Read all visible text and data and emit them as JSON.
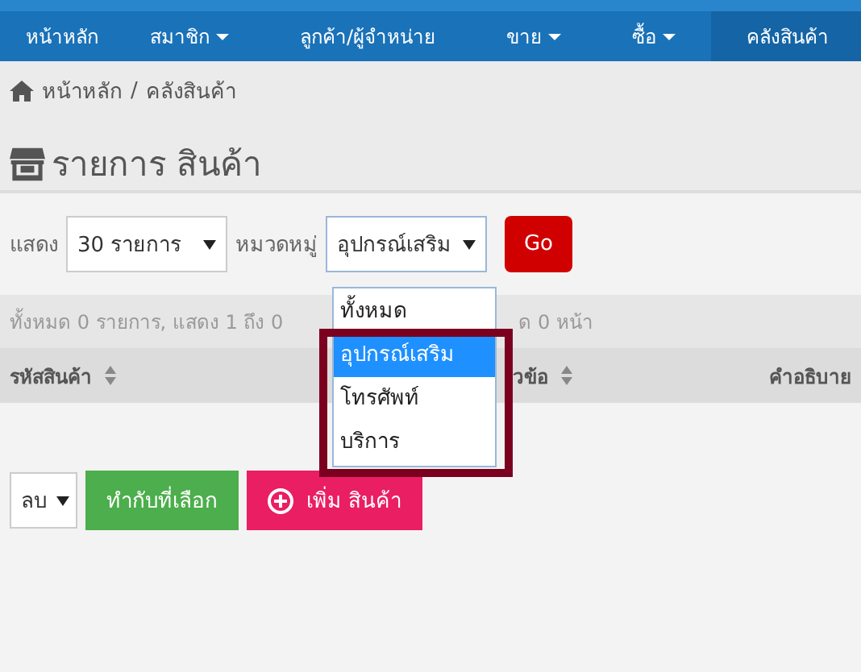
{
  "navbar": {
    "items": [
      {
        "label": "หน้าหลัก",
        "dropdown": false,
        "selected": false
      },
      {
        "label": "สมาชิก",
        "dropdown": true,
        "selected": false
      },
      {
        "label": "ลูกค้า/ผู้จำหน่าย",
        "dropdown": false,
        "selected": false
      },
      {
        "label": "ขาย",
        "dropdown": true,
        "selected": false
      },
      {
        "label": "ซื้อ",
        "dropdown": true,
        "selected": false
      },
      {
        "label": "คลังสินค้า",
        "dropdown": false,
        "selected": true
      }
    ]
  },
  "breadcrumb": [
    "หน้าหลัก",
    "/",
    "คลังสินค้า"
  ],
  "page_title": "รายการ สินค้า",
  "filters": {
    "show_label": "แสดง",
    "show_value": "30 รายการ",
    "category_label": "หมวดหมู่",
    "category_value": "อุปกรณ์เสริม",
    "go_button": "Go"
  },
  "category_options": [
    {
      "label": "ทั้งหมด",
      "selected": false
    },
    {
      "label": "อุปกรณ์เสริม",
      "selected": true
    },
    {
      "label": "โทรศัพท์",
      "selected": false
    },
    {
      "label": "บริการ",
      "selected": false
    }
  ],
  "info_text": [
    "ทั้งหมด 0 รายการ, แสดง 1 ถึง 0",
    "ด 0 หน้า"
  ],
  "table": {
    "columns": [
      {
        "label": "รหัสสินค้า",
        "sortable": true
      },
      {
        "label": "วข้อ",
        "sortable": true
      },
      {
        "label": "คำอธิบาย",
        "sortable": false
      }
    ]
  },
  "actions": {
    "bulk_value": "ลบ",
    "apply_button": "ทำกับที่เลือก",
    "add_button": "เพิ่ม สินค้า"
  },
  "annotation_frame": true
}
